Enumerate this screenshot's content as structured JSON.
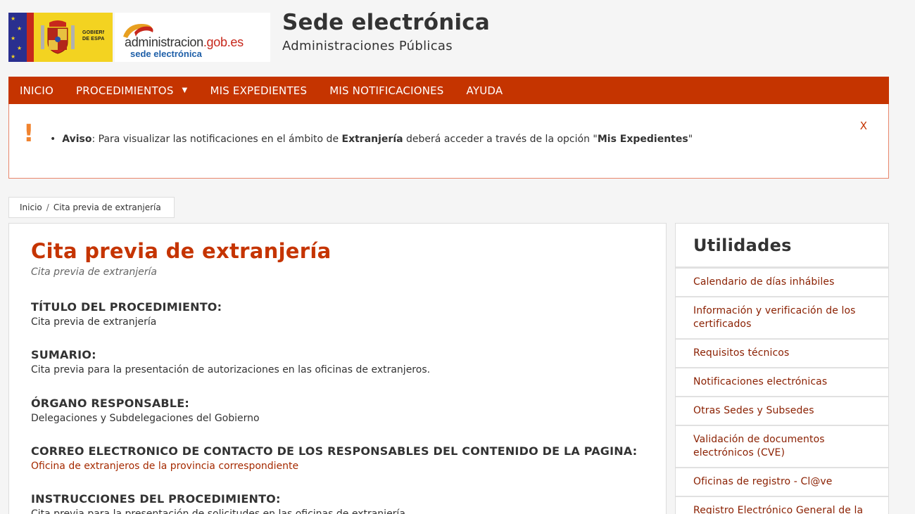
{
  "header": {
    "gob_text_line1": "GOBIERNO",
    "gob_text_line2": "DE ESPAÑA",
    "admin_name": "administracion",
    "admin_domain": ".gob.es",
    "admin_sub": "sede electrónica",
    "title": "Sede electrónica",
    "subtitle": "Administraciones Públicas"
  },
  "nav": {
    "items": [
      {
        "label": "INICIO"
      },
      {
        "label": "PROCEDIMIENTOS"
      },
      {
        "label": "MIS EXPEDIENTES"
      },
      {
        "label": "MIS NOTIFICACIONES"
      },
      {
        "label": "AYUDA"
      }
    ]
  },
  "alert": {
    "icon": "!",
    "bold1": "Aviso",
    "text1": ": Para visualizar las notificaciones en el ámbito de ",
    "bold2": "Extranjería",
    "text2": " deberá acceder a través de la opción \"",
    "bold3": "Mis Expedientes",
    "text3": "\"",
    "close": "X"
  },
  "breadcrumb": {
    "home": "Inicio",
    "sep": "/",
    "current": "Cita previa de extranjería"
  },
  "main": {
    "title": "Cita previa de extranjería",
    "subtitle": "Cita previa de extranjería",
    "fields": [
      {
        "label": "TÍTULO DEL PROCEDIMIENTO:",
        "value": "Cita previa de extranjería"
      },
      {
        "label": "SUMARIO:",
        "value": "Cita previa para la presentación de autorizaciones en las oficinas de extranjeros."
      },
      {
        "label": "ÓRGANO RESPONSABLE:",
        "value": "Delegaciones y Subdelegaciones del Gobierno"
      },
      {
        "label": "CORREO ELECTRONICO DE CONTACTO DE LOS RESPONSABLES DEL CONTENIDO DE LA PAGINA:",
        "value": "Oficina de extranjeros de la provincia correspondiente"
      },
      {
        "label": "INSTRUCCIONES DEL PROCEDIMIENTO:",
        "value": "Cita previa para la presentación de solicitudes en las oficinas de extranjería."
      }
    ]
  },
  "sidebar": {
    "title": "Utilidades",
    "items": [
      {
        "label": "Calendario de días inhábiles"
      },
      {
        "label": "Información y verificación de los certificados"
      },
      {
        "label": "Requisitos técnicos"
      },
      {
        "label": "Notificaciones electrónicas"
      },
      {
        "label": "Otras Sedes y Subsedes"
      },
      {
        "label": "Validación de documentos electrónicos (CVE)"
      },
      {
        "label": "Oficinas de registro - Cl@ve"
      },
      {
        "label": "Registro Electrónico General de la AGE"
      }
    ]
  },
  "colors": {
    "nav_bg": "#c53400",
    "accent": "#c53400",
    "link": "#8a1f00",
    "alert_icon": "#f0832f"
  }
}
